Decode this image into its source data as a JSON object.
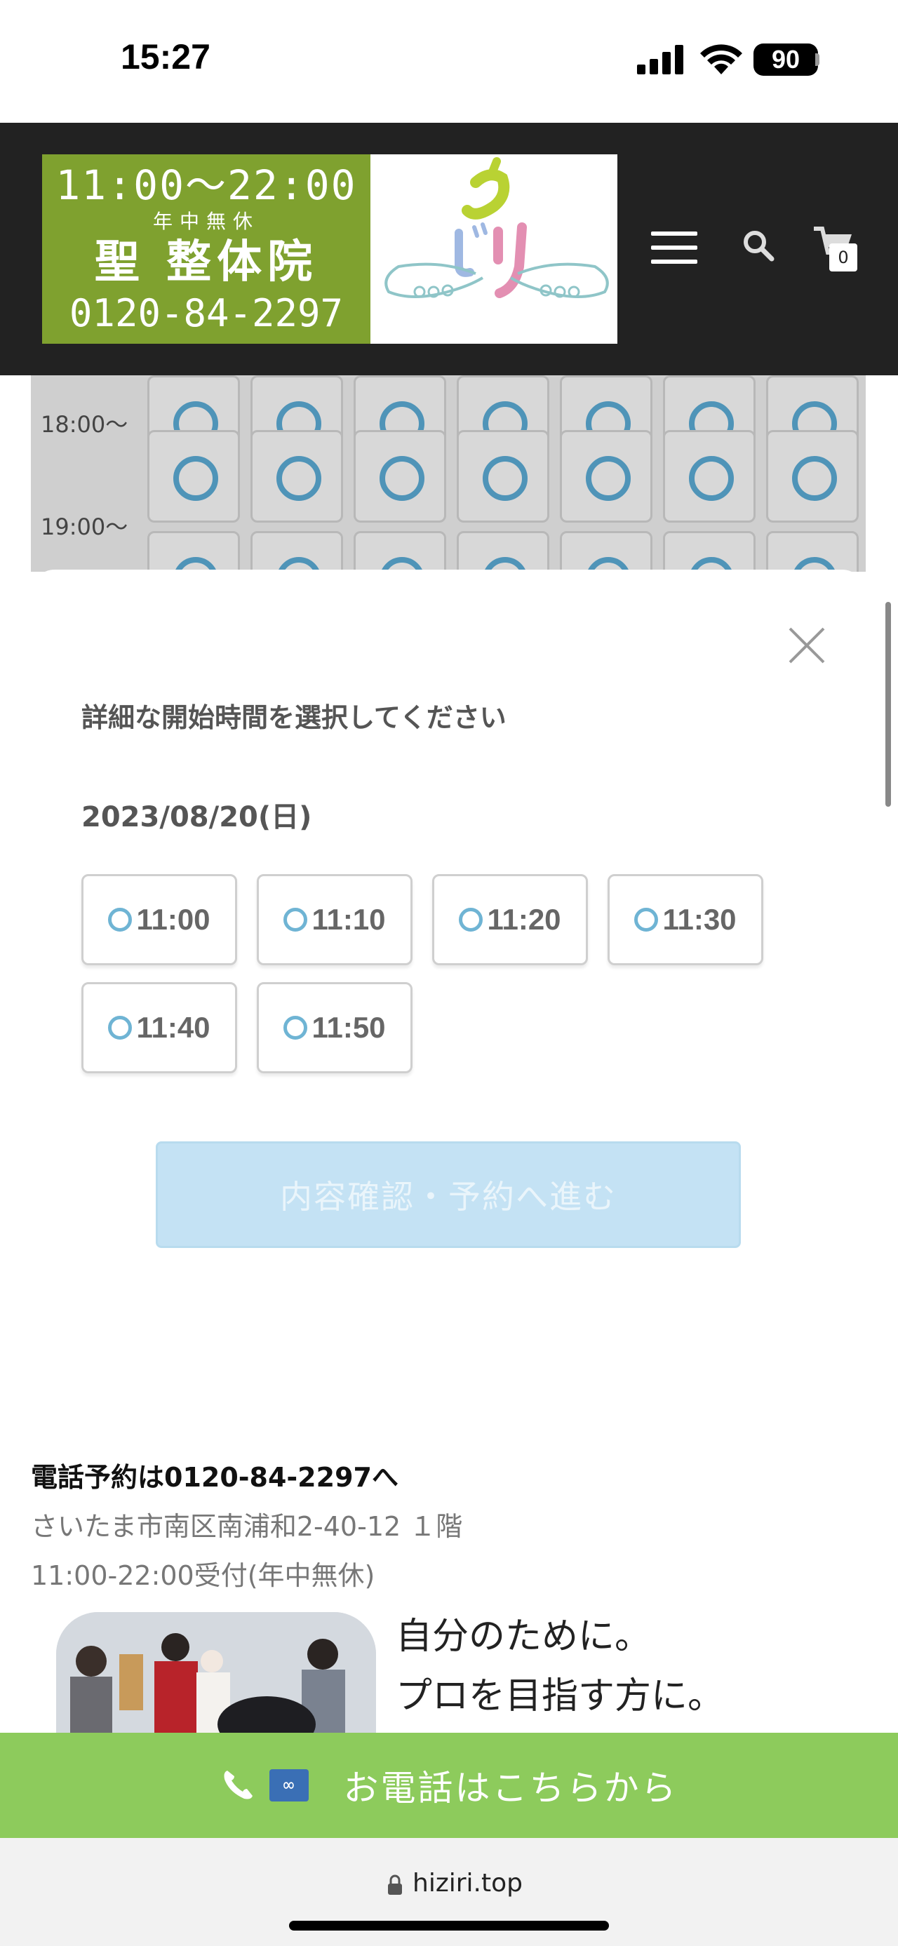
{
  "status_bar": {
    "time": "15:27",
    "battery": "90"
  },
  "header": {
    "banner": {
      "hours": "11:00～22:00",
      "holiday": "年中無休",
      "clinic_name": "聖 整体院",
      "phone": "0120-84-2297"
    },
    "cart_count": "0"
  },
  "schedule": {
    "rows": [
      {
        "time": "18:00～"
      },
      {
        "time": "19:00～"
      }
    ],
    "slot_icon": "circle-available-icon"
  },
  "modal": {
    "title": "詳細な開始時間を選択してください",
    "date": "2023/08/20(日)",
    "time_options": [
      "11:00",
      "11:10",
      "11:20",
      "11:30",
      "11:40",
      "11:50"
    ],
    "proceed_label": "内容確認・予約へ進む"
  },
  "info": {
    "phone_line": "電話予約は0120-84-2297へ",
    "address": "さいたま市南区南浦和2-40-12 １階",
    "hours": "11:00-22:00受付(年中無休)"
  },
  "promo": {
    "line1": "自分のために。",
    "line2": "プロを目指す方に。"
  },
  "call_bar": {
    "label": "お電話はこちらから"
  },
  "browser": {
    "url": "hiziri.top"
  },
  "colors": {
    "header_bg": "#222222",
    "banner_green": "#7fa12f",
    "slot_ring": "#4f94b8",
    "proceed_bg": "#c4e2f4",
    "call_bar_green": "#8dcb5c"
  }
}
